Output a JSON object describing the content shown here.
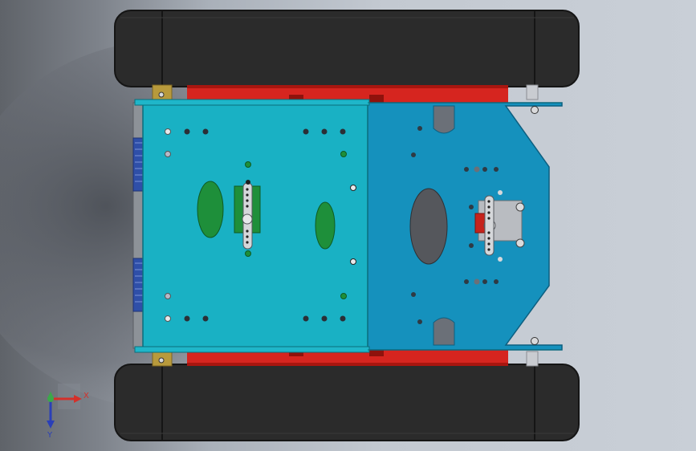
{
  "triad": {
    "x_label": "X",
    "y_label": "Y",
    "x_color": "#d4302a",
    "y_color": "#2a3fb8",
    "origin_color": "#3ca84a"
  },
  "colors": {
    "track": "#2b2b2b",
    "track_edge": "#171717",
    "frame_red": "#d6251f",
    "upper_plate": "#19b1c4",
    "lower_plate": "#1591bd",
    "pad_green": "#1e8f3a",
    "cutout": "#55575c"
  },
  "icons": {
    "triad": "coordinate-triad-icon",
    "servo_horn": "servo-horn-icon",
    "screw": "screw-head-icon"
  }
}
